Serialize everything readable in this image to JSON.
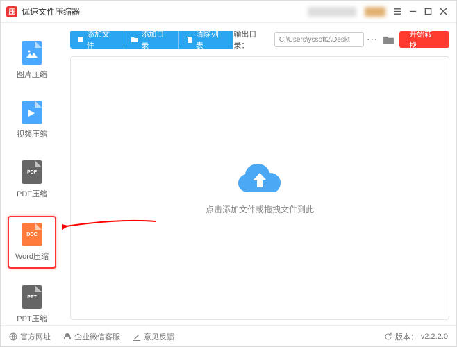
{
  "app": {
    "title": "优速文件压缩器"
  },
  "sidebar": {
    "items": [
      {
        "label": "图片压缩",
        "tag": "",
        "color": "#4aa8ff"
      },
      {
        "label": "视频压缩",
        "tag": "",
        "color": "#4aa8ff"
      },
      {
        "label": "PDF压缩",
        "tag": "PDF",
        "color": "#666"
      },
      {
        "label": "Word压缩",
        "tag": "DOC",
        "color": "#ff7a3d"
      },
      {
        "label": "PPT压缩",
        "tag": "PPT",
        "color": "#666"
      }
    ]
  },
  "toolbar": {
    "add_file": "添加文件",
    "add_folder": "添加目录",
    "clear_list": "清除列表",
    "output_label": "输出目录：",
    "output_path": "C:\\Users\\yssoft2\\Deskt",
    "start": "开始转换"
  },
  "drop": {
    "hint": "点击添加文件或拖拽文件到此"
  },
  "footer": {
    "website": "官方网址",
    "wechat": "企业微信客服",
    "feedback": "意见反馈",
    "version_label": "版本：",
    "version": "v2.2.2.0"
  }
}
